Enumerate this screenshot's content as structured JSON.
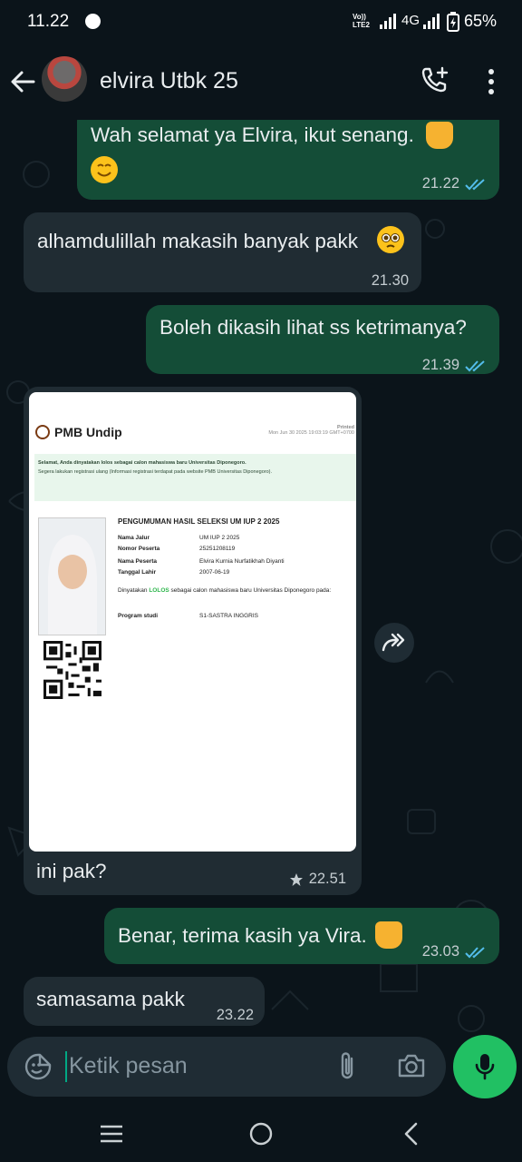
{
  "status_bar": {
    "time": "11.22",
    "volte": "Vo))\nLTE2",
    "network": "4G",
    "battery": "65%"
  },
  "header": {
    "contact_name": "elvira Utbk 25",
    "icons": [
      "back-arrow-icon",
      "avatar",
      "add-call-icon",
      "more-vert-icon"
    ]
  },
  "messages": [
    {
      "dir": "out",
      "text": "Wah selamat ya Elvira, ikut senang.",
      "emoji": [
        "thumbs-up",
        "smiling-face"
      ],
      "time": "21.22",
      "ticks": "read"
    },
    {
      "dir": "in",
      "text": "alhamdulillah makasih banyak pakk",
      "emoji": [
        "pleading-face"
      ],
      "time": "21.30"
    },
    {
      "dir": "out",
      "text": "Boleh dikasih lihat ss ketrimanya?",
      "time": "21.39",
      "ticks": "read"
    },
    {
      "dir": "in",
      "type": "image",
      "caption": "ini pak?",
      "time": "22.51",
      "starred": true
    },
    {
      "dir": "out",
      "text": "Benar, terima kasih ya Vira.",
      "emoji": [
        "thumbs-up"
      ],
      "time": "23.03",
      "ticks": "read"
    },
    {
      "dir": "in",
      "text": "samasama pakk",
      "time": "23.22"
    }
  ],
  "screenshot_doc": {
    "brand": "PMB Undip",
    "printed_label": "Printed",
    "printed_date": "Mon Jun 30 2025 19:03:19 GMT+0700",
    "notice_1": "Selamat, Anda dinyatakan lolos sebagai calon mahasiswa baru Universitas Diponegoro.",
    "notice_2": "Segera lakukan registrasi ulang (Informasi registrasi terdapat pada website PMB Universitas Diponegoro).",
    "title": "PENGUMUMAN HASIL SELEKSI UM IUP 2 2025",
    "fields": [
      {
        "k": "Nama Jalur",
        "v": "UM IUP 2 2025"
      },
      {
        "k": "Nomor Peserta",
        "v": "25251208119"
      },
      {
        "k": "Nama Peserta",
        "v": "Elvira Kurnia Nurfatikhah Diyanti"
      },
      {
        "k": "Tanggal Lahir",
        "v": "2007-06-19"
      }
    ],
    "decl_before": "Dinyatakan ",
    "decl_lolos": "LOLOS",
    "decl_after": " sebagai calon mahasiswa baru Universitas Diponegoro pada:",
    "program_key": "Program studi",
    "program_val": "S1-SASTRA INGGRIS"
  },
  "input": {
    "placeholder": "Ketik pesan"
  },
  "colors": {
    "background": "#0b141a",
    "outgoing_bubble": "#144d37",
    "incoming_bubble": "#202c33",
    "read_ticks": "#53bdeb",
    "mic_button": "#21c063"
  }
}
